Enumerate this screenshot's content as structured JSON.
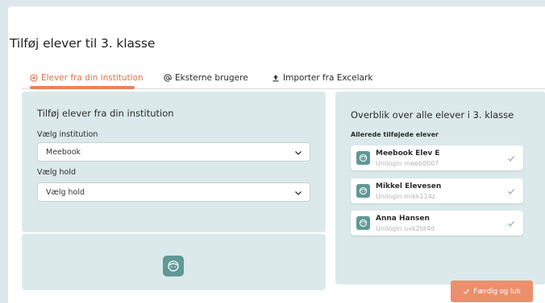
{
  "modal": {
    "title": "Tilføj elever til 3. klasse"
  },
  "tabs": [
    {
      "label": "Elever fra din institution",
      "icon": "target-icon",
      "active": true
    },
    {
      "label": "Eksterne brugere",
      "icon": "at-icon",
      "active": false
    },
    {
      "label": "Importer fra Excelark",
      "icon": "upload-icon",
      "active": false
    }
  ],
  "left_panel": {
    "title": "Tilføj elever fra din institution",
    "institution_label": "Vælg institution",
    "institution_value": "Meebook",
    "hold_label": "Vælg hold",
    "hold_value": "Vælg hold"
  },
  "right_panel": {
    "title": "Overblik over alle elever i 3. klasse",
    "subheading": "Allerede tilføjede elever",
    "students": [
      {
        "name": "Meebook Elev E",
        "unilogin": "Unilogin meeb0007"
      },
      {
        "name": "Mikkel Elevesen",
        "unilogin": "Unilogin mikk114z"
      },
      {
        "name": "Anna Hansen",
        "unilogin": "Unilogin uvk2bt4d"
      }
    ]
  },
  "footer": {
    "done_label": "Færdig og luk"
  },
  "colors": {
    "accent": "#e4704b",
    "button": "#ec8f6d",
    "panel": "#dbe9ea",
    "avatar": "#5f9896",
    "backdrop": "#dde8ec"
  }
}
